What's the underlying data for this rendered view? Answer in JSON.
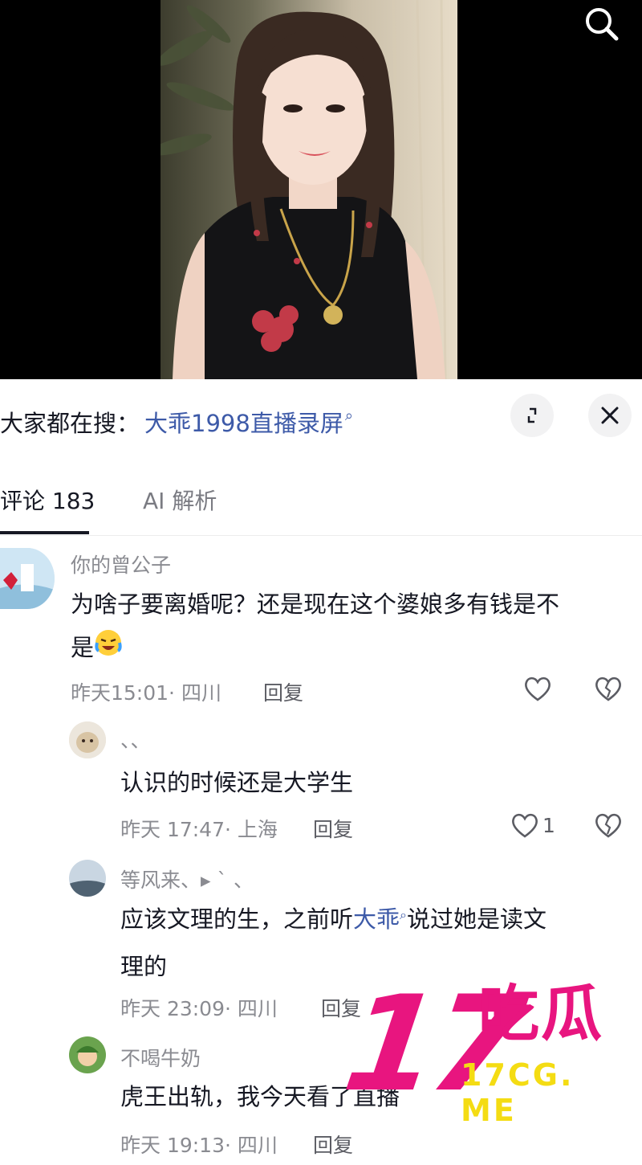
{
  "search": {
    "hot_prefix": "大家都在搜：",
    "hot_term": "大乖1998直播录屏",
    "hot_icon": "search-mini-icon"
  },
  "tabs": [
    {
      "label": "评论 183",
      "active": true
    },
    {
      "label": "AI 解析",
      "active": false
    }
  ],
  "comments": [
    {
      "username": "你的曾公子",
      "text_line1": "为啥子要离婚呢？还是现在这个婆娘多有钱是不",
      "text_line2": "是",
      "time": "昨天15:01",
      "location": "四川",
      "reply": "回复",
      "likes": ""
    },
    {
      "username": "、、",
      "text_line1": "认识的时候还是大学生",
      "time": "昨天 17:47",
      "location": "上海",
      "reply": "回复",
      "likes": "1"
    },
    {
      "username": "等风来、▸ ˋ 、",
      "text_before_link": "应该文理的生，之前听",
      "link": "大乖",
      "text_after_link": "说过她是读文",
      "text_line2": "理的",
      "time": "昨天 23:09",
      "location": "四川",
      "reply": "回复"
    },
    {
      "username": "不喝牛奶",
      "text_line1": "虎王出轨，我今天看了直播",
      "time": "昨天 19:13",
      "location": "四川",
      "reply": "回复"
    }
  ],
  "watermark": {
    "number": "17",
    "chinese": "吃瓜",
    "site": "17CG. ME",
    "color_primary": "#e8157f",
    "color_secondary": "#f4dc13"
  },
  "colors": {
    "link": "#3d5aa8",
    "muted": "#8a8b91",
    "text": "#161823"
  }
}
